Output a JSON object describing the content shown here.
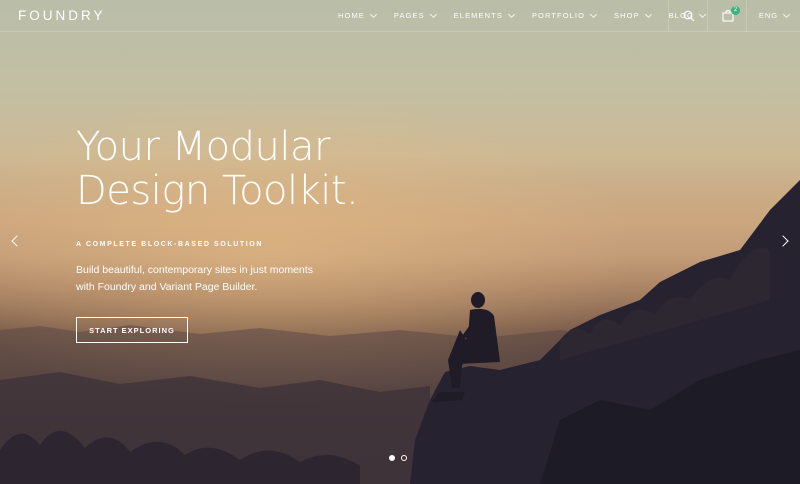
{
  "brand": {
    "name": "FOUNDRY"
  },
  "nav": {
    "items": [
      {
        "label": "HOME"
      },
      {
        "label": "PAGES"
      },
      {
        "label": "ELEMENTS"
      },
      {
        "label": "PORTFOLIO"
      },
      {
        "label": "SHOP"
      },
      {
        "label": "BLOG"
      }
    ],
    "search_icon": "search-icon",
    "cart_icon": "shopping-bag-icon",
    "cart_count": "2",
    "language": "ENG"
  },
  "hero": {
    "title_lines": [
      "Your Modular",
      "Design Toolkit."
    ],
    "eyebrow": "A COMPLETE BLOCK-BASED SOLUTION",
    "description_lines": [
      "Build beautiful, contemporary sites in just moments",
      "with Foundry and Variant Page Builder."
    ],
    "cta_label": "START EXPLORING"
  },
  "slider": {
    "total": 2,
    "active": 1,
    "prev_icon": "chevron-left-icon",
    "next_icon": "chevron-right-icon"
  },
  "colors": {
    "badge": "#3fb37e",
    "text": "#ffffff"
  }
}
